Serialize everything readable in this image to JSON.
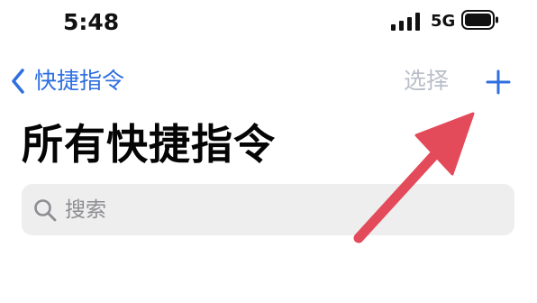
{
  "status_bar": {
    "time": "5:48",
    "network": "5G",
    "icons": [
      "signal-icon",
      "battery-icon"
    ]
  },
  "nav": {
    "back_label": "快捷指令",
    "select_label": "选择",
    "add_icon": "plus-icon"
  },
  "page": {
    "title": "所有快捷指令"
  },
  "search": {
    "placeholder": "搜索",
    "icon": "search-icon"
  },
  "annotation": {
    "icon": "red-arrow-icon"
  },
  "colors": {
    "accent": "#2f6fe0",
    "disabled": "#b8bfc9",
    "search_bg": "#eeeeef",
    "arrow": "#e34a5a"
  }
}
